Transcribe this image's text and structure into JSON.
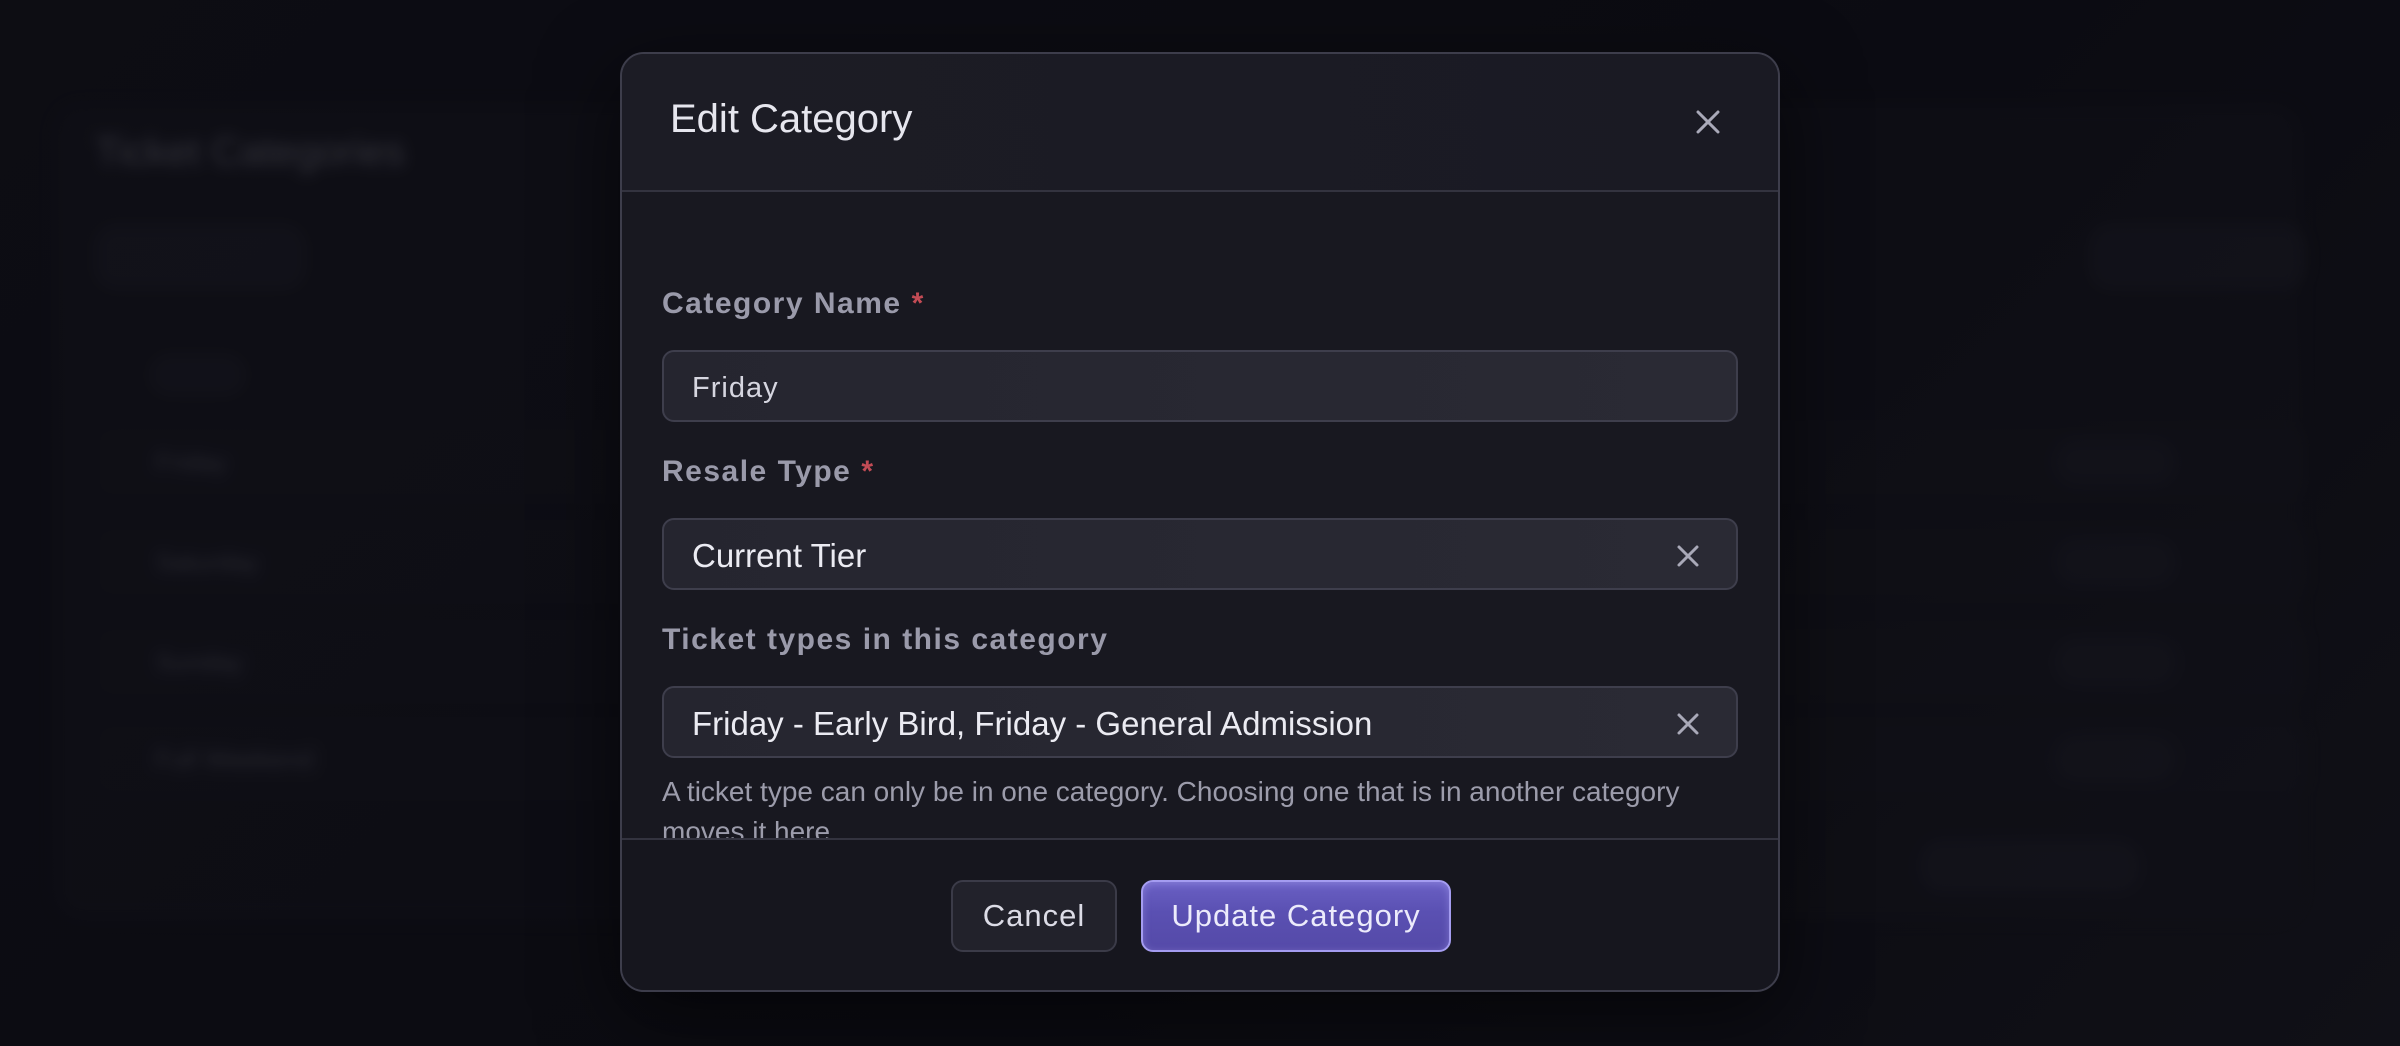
{
  "background": {
    "page_title": "Ticket Categories",
    "rows": [
      "Friday",
      "Saturday",
      "Sunday",
      "Full Weekend"
    ]
  },
  "modal": {
    "title": "Edit Category",
    "close_icon": "close-icon",
    "fields": {
      "category_name": {
        "label": "Category Name",
        "required_marker": "*",
        "value": "Friday"
      },
      "resale_type": {
        "label": "Resale Type",
        "required_marker": "*",
        "value": "Current Tier"
      },
      "ticket_types": {
        "label": "Ticket types in this category",
        "value": "Friday - Early Bird, Friday - General Admission",
        "helper": "A ticket type can only be in one category. Choosing one that is in another category moves it here."
      }
    },
    "footer": {
      "cancel_label": "Cancel",
      "update_label": "Update Category"
    }
  },
  "colors": {
    "accent": "#5b51b4",
    "required": "#c34b55",
    "surface": "#181820"
  }
}
